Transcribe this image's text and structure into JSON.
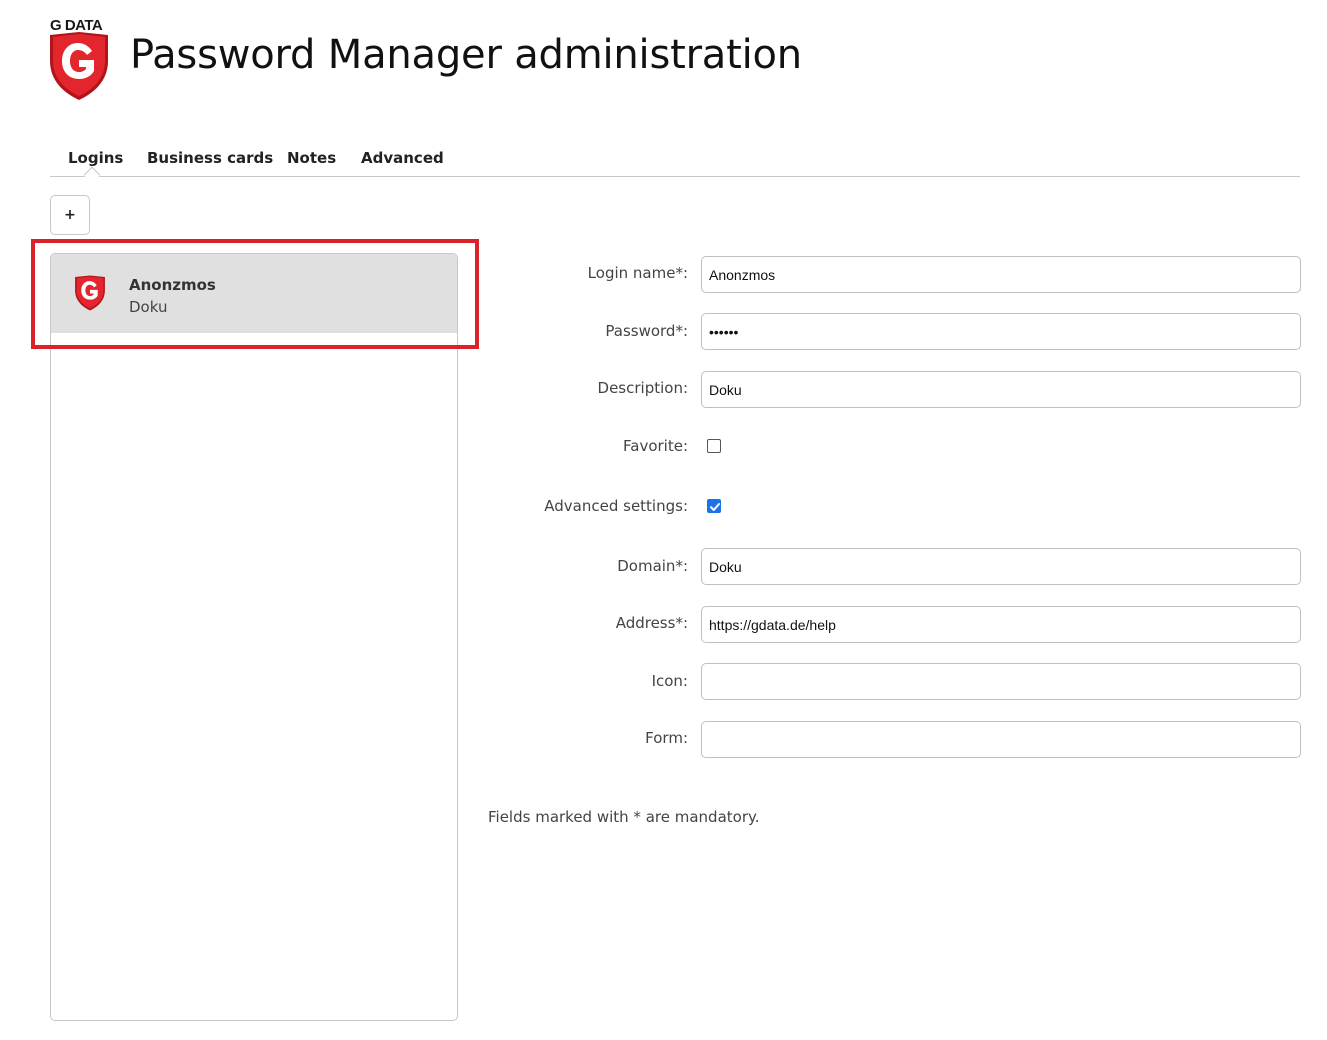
{
  "brand": {
    "logo_text": "G DATA",
    "color": "#d9222a"
  },
  "page": {
    "title": "Password Manager administration"
  },
  "tabs": [
    {
      "label": "Logins",
      "active": true
    },
    {
      "label": "Business cards"
    },
    {
      "label": "Notes"
    },
    {
      "label": "Advanced"
    }
  ],
  "toolbar": {
    "add_label": "+"
  },
  "logins": [
    {
      "name": "Anonzmos",
      "description": "Doku",
      "icon": "gdata-shield-icon",
      "selected": true
    }
  ],
  "form": {
    "login_name": {
      "label": "Login name*:",
      "value": "Anonzmos"
    },
    "password": {
      "label": "Password*:",
      "value": "••••••"
    },
    "description": {
      "label": "Description:",
      "value": "Doku"
    },
    "favorite": {
      "label": "Favorite:",
      "checked": false
    },
    "advanced_settings": {
      "label": "Advanced settings:",
      "checked": true
    },
    "domain": {
      "label": "Domain*:",
      "value": "Doku"
    },
    "address": {
      "label": "Address*:",
      "value": "https://gdata.de/help"
    },
    "icon": {
      "label": "Icon:",
      "value": ""
    },
    "form": {
      "label": "Form:",
      "value": ""
    }
  },
  "footer": {
    "mandatory_note": "Fields marked with * are mandatory."
  },
  "colors": {
    "highlight": "#d9222a",
    "checkbox_checked": "#1a73e8",
    "selected_row": "#e0e0e0"
  }
}
